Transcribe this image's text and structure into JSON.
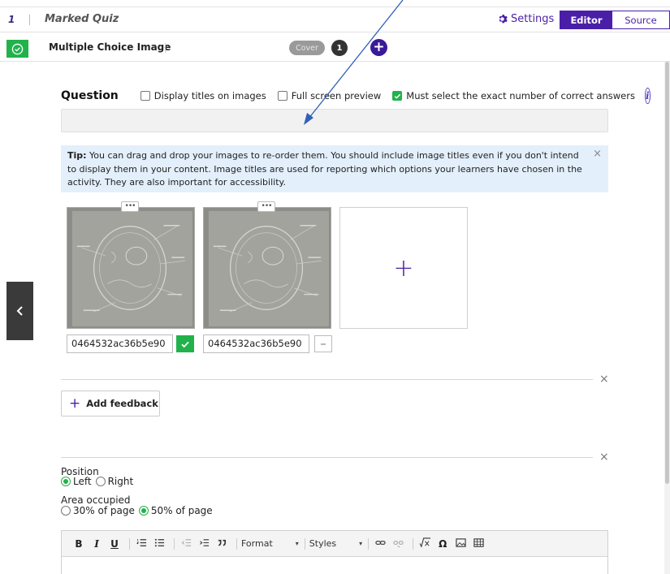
{
  "header": {
    "slide_number": "1",
    "quiz_title": "Marked Quiz",
    "settings_label": "Settings",
    "tabs": [
      {
        "label": "Editor",
        "active": true
      },
      {
        "label": "Source",
        "active": false
      }
    ]
  },
  "block_bar": {
    "title": "Multiple Choice Image",
    "cover_label": "Cover",
    "page_number": "1",
    "add_label": "+"
  },
  "question": {
    "label": "Question",
    "options": [
      {
        "label": "Display titles on images",
        "checked": false
      },
      {
        "label": "Full screen preview",
        "checked": false
      },
      {
        "label": "Must select the exact number of correct answers",
        "checked": true
      }
    ],
    "info_icon": "i",
    "value": ""
  },
  "tip": {
    "prefix": "Tip:",
    "text": "You can drag and drop your images to re-order them. You should include image titles even if you don't intend to display them in your content. Image titles are used for reporting which options your learners have chosen in the activity. They are also important for accessibility.",
    "close": "×"
  },
  "images": [
    {
      "title_value": "0464532ac36b5e90",
      "correct": true,
      "handle": "•••"
    },
    {
      "title_value": "0464532ac36b5e90",
      "correct": false,
      "handle": "•••"
    }
  ],
  "add_image_symbol": "+",
  "feedback": {
    "button_label": "Add feedback",
    "plus": "+",
    "close": "×"
  },
  "layout_section": {
    "close": "×",
    "position_label": "Position",
    "position_options": [
      {
        "label": "Left",
        "selected": true
      },
      {
        "label": "Right",
        "selected": false
      }
    ],
    "area_label": "Area occupied",
    "area_options": [
      {
        "label": "30% of page",
        "selected": false
      },
      {
        "label": "50% of page",
        "selected": true
      }
    ]
  },
  "editor_toolbar": {
    "bold": "B",
    "italic": "I",
    "underline": "U",
    "format_label": "Format",
    "styles_label": "Styles",
    "omega": "Ω"
  },
  "colors": {
    "brand_purple": "#4a1fa8",
    "success_green": "#22b24c",
    "tip_background": "#e3effb"
  }
}
